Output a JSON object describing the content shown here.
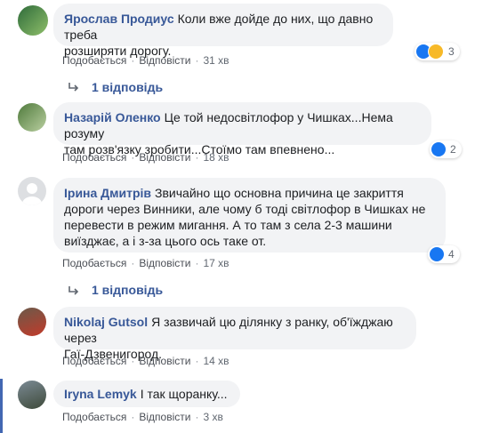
{
  "comments": [
    {
      "author": "Ярослав Продиус",
      "text_line1": "Коли вже дойде до них, що давно треба",
      "text_line2": "розширяти дорогу.",
      "like_label": "Подобається",
      "reply_label": "Відповісти",
      "time": "31 хв",
      "reactions": [
        "like",
        "haha"
      ],
      "reaction_count": "3",
      "replies_label": "1 відповідь"
    },
    {
      "author": "Назарій Оленко",
      "text_line1": "Це той недосвітлофор у Чишках...Нема розуму",
      "text_line2": "там розв'язку зробити...Стоїмо там впевнено...",
      "like_label": "Подобається",
      "reply_label": "Відповісти",
      "time": "18 хв",
      "reactions": [
        "like"
      ],
      "reaction_count": "2"
    },
    {
      "author": "Ірина Дмитрів",
      "text_line1": "Звичайно що основна причина це закриття",
      "text_line2": "дороги через Винники, але чому б тоді світлофор в Чишках не",
      "text_line3": "перевести в режим мигання. А то там з села 2-3 машини",
      "text_line4": "виїзджає, а і з-за цього ось таке от.",
      "like_label": "Подобається",
      "reply_label": "Відповісти",
      "time": "17 хв",
      "reactions": [
        "like"
      ],
      "reaction_count": "4",
      "replies_label": "1 відповідь"
    },
    {
      "author": "Nikolaj Gutsol",
      "text_line1": "Я зазвичай цю ділянку з ранку, об'їжджаю через",
      "text_line2": "Гаї-Дзвенигород.",
      "like_label": "Подобається",
      "reply_label": "Відповісти",
      "time": "14 хв"
    },
    {
      "author": "Iryna Lemyk",
      "text_line1": "І так щоранку...",
      "like_label": "Подобається",
      "reply_label": "Відповісти",
      "time": "3 хв"
    }
  ],
  "colors": {
    "author": "#385898",
    "bubble": "#f2f3f5",
    "like": "#1877f2",
    "haha": "#f7b928"
  }
}
